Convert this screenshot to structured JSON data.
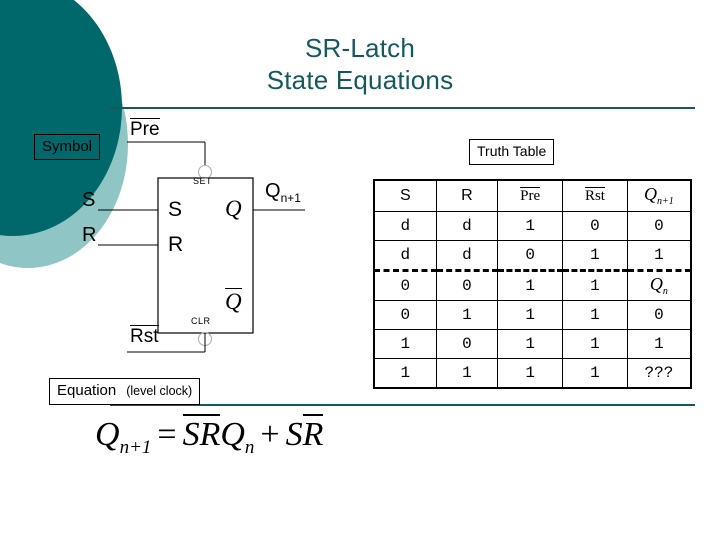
{
  "slide": {
    "title_line1": "SR-Latch",
    "title_line2": "State Equations",
    "title_color": "#15595c",
    "background": "#ffffff"
  },
  "decoration": {
    "circle_dark_color": "#00686b",
    "circle_light_color": "#8fc5c5"
  },
  "captions": {
    "symbol": "Symbol",
    "truth_table": "Truth Table",
    "equation": "Equation",
    "equation_note": "(level clock)"
  },
  "symbol_diagram": {
    "top_signal": "Pre",
    "top_signal_overbar": true,
    "bottom_signal": "Rst",
    "bottom_signal_overbar": true,
    "set_bubble_label": "SET",
    "clr_bubble_label": "CLR",
    "external_inputs": [
      "S",
      "R"
    ],
    "block_inputs": [
      "S",
      "R"
    ],
    "block_outputs": [
      "Q",
      "Q"
    ],
    "block_output_q_overbar": false,
    "block_output_qbar_overbar": true,
    "external_output": "Q",
    "external_output_sub": "n+1"
  },
  "truth_table": {
    "headers": [
      {
        "text": "S",
        "overbar": false,
        "style": "plain"
      },
      {
        "text": "R",
        "overbar": false,
        "style": "plain"
      },
      {
        "text": "Pre",
        "overbar": true,
        "style": "serif"
      },
      {
        "text": "Rst",
        "overbar": true,
        "style": "serif"
      },
      {
        "text": "Q",
        "sub": "n+1",
        "overbar": false,
        "style": "serif-italic"
      }
    ],
    "rows": [
      {
        "cells": [
          "d",
          "d",
          "1",
          "0",
          "0"
        ],
        "q_sub": ""
      },
      {
        "cells": [
          "d",
          "d",
          "0",
          "1",
          "1"
        ],
        "q_sub": ""
      },
      {
        "cells": [
          "0",
          "0",
          "1",
          "1",
          "Q"
        ],
        "q_sub": "n"
      },
      {
        "cells": [
          "0",
          "1",
          "1",
          "1",
          "0"
        ],
        "q_sub": ""
      },
      {
        "cells": [
          "1",
          "0",
          "1",
          "1",
          "1"
        ],
        "q_sub": ""
      },
      {
        "cells": [
          "1",
          "1",
          "1",
          "1",
          "???"
        ],
        "q_sub": ""
      }
    ],
    "vertical_separator_after_column": 2,
    "horizontal_separator_after_row": 2
  },
  "equation": {
    "lhs": "Q",
    "lhs_sub": "n+1",
    "equals": "=",
    "term1": {
      "s_bar": "S",
      "r_bar": "R",
      "q": "Q",
      "q_sub": "n"
    },
    "plus": "+",
    "term2": {
      "s": "S",
      "r_bar": "R"
    },
    "full_text": "Qn+1 = S̄R̄Qn + SR̄"
  }
}
